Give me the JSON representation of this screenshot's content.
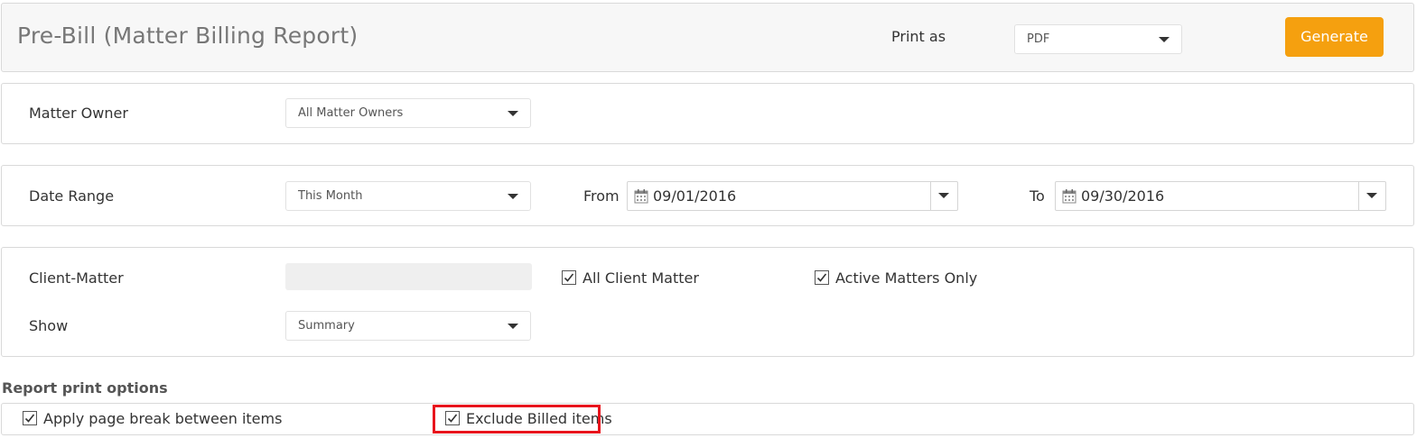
{
  "header": {
    "title": "Pre-Bill (Matter Billing Report)",
    "print_as_label": "Print as",
    "print_as_value": "PDF",
    "generate_label": "Generate",
    "generate_color": "#f5a00f"
  },
  "matter_owner": {
    "label": "Matter Owner",
    "value": "All Matter Owners"
  },
  "date_range": {
    "label": "Date Range",
    "value": "This Month",
    "from_label": "From",
    "from_value": "09/01/2016",
    "to_label": "To",
    "to_value": "09/30/2016"
  },
  "client_matter": {
    "label": "Client-Matter",
    "value": "",
    "all_client_matter_label": "All Client Matter",
    "all_client_matter_checked": true,
    "active_matters_only_label": "Active Matters Only",
    "active_matters_only_checked": true,
    "show_label": "Show",
    "show_value": "Summary"
  },
  "report_print_options": {
    "heading": "Report print options",
    "page_break_label": "Apply page break between items",
    "page_break_checked": true,
    "exclude_billed_label": "Exclude Billed items",
    "exclude_billed_checked": true,
    "highlight_color": "#e8141c"
  },
  "icons": {
    "calendar": "calendar-icon",
    "dropdown": "chevron-down-icon",
    "check": "checkmark-icon"
  }
}
